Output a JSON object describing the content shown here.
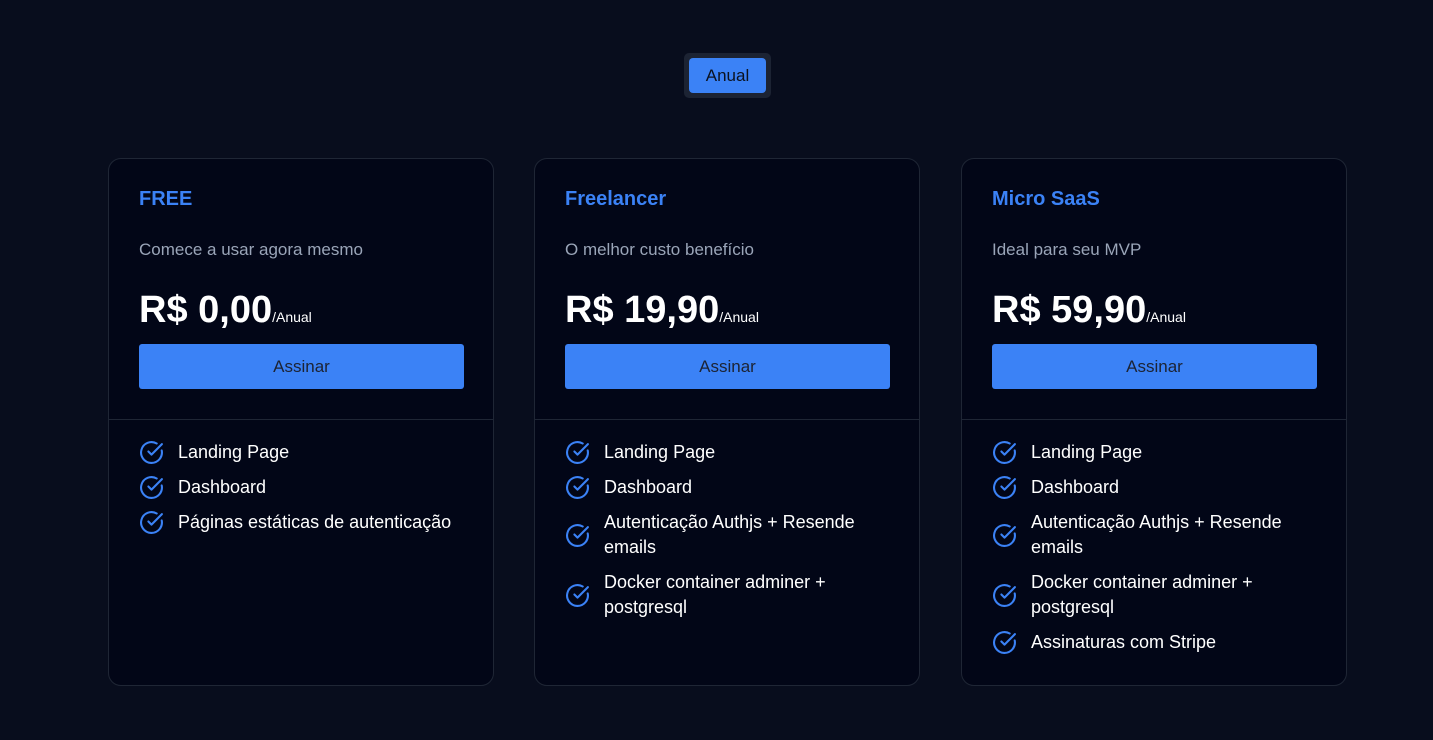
{
  "billing_toggle": {
    "label": "Anual"
  },
  "colors": {
    "accent": "#3b82f6",
    "background": "#080d1d",
    "card": "#020617"
  },
  "plans": [
    {
      "name": "FREE",
      "description": "Comece a usar agora mesmo",
      "price": "R$ 0,00",
      "period": "/Anual",
      "button_label": "Assinar",
      "features": [
        "Landing Page",
        "Dashboard",
        "Páginas estáticas de autenticação"
      ]
    },
    {
      "name": "Freelancer",
      "description": "O melhor custo benefício",
      "price": "R$ 19,90",
      "period": "/Anual",
      "button_label": "Assinar",
      "features": [
        "Landing Page",
        "Dashboard",
        "Autenticação Authjs + Resende emails",
        "Docker container adminer + postgresql"
      ]
    },
    {
      "name": "Micro SaaS",
      "description": "Ideal para seu MVP",
      "price": "R$ 59,90",
      "period": "/Anual",
      "button_label": "Assinar",
      "features": [
        "Landing Page",
        "Dashboard",
        "Autenticação Authjs + Resende emails",
        "Docker container adminer + postgresql",
        "Assinaturas com Stripe"
      ]
    }
  ]
}
